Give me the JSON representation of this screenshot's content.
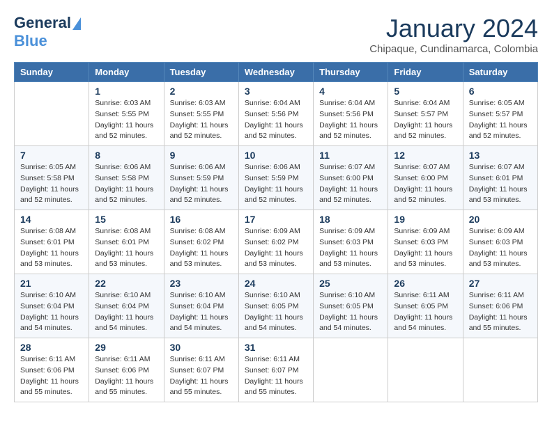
{
  "header": {
    "logo_line1": "General",
    "logo_line2": "Blue",
    "month_title": "January 2024",
    "subtitle": "Chipaque, Cundinamarca, Colombia"
  },
  "days_of_week": [
    "Sunday",
    "Monday",
    "Tuesday",
    "Wednesday",
    "Thursday",
    "Friday",
    "Saturday"
  ],
  "weeks": [
    [
      {
        "day": "",
        "info": ""
      },
      {
        "day": "1",
        "info": "Sunrise: 6:03 AM\nSunset: 5:55 PM\nDaylight: 11 hours\nand 52 minutes."
      },
      {
        "day": "2",
        "info": "Sunrise: 6:03 AM\nSunset: 5:55 PM\nDaylight: 11 hours\nand 52 minutes."
      },
      {
        "day": "3",
        "info": "Sunrise: 6:04 AM\nSunset: 5:56 PM\nDaylight: 11 hours\nand 52 minutes."
      },
      {
        "day": "4",
        "info": "Sunrise: 6:04 AM\nSunset: 5:56 PM\nDaylight: 11 hours\nand 52 minutes."
      },
      {
        "day": "5",
        "info": "Sunrise: 6:04 AM\nSunset: 5:57 PM\nDaylight: 11 hours\nand 52 minutes."
      },
      {
        "day": "6",
        "info": "Sunrise: 6:05 AM\nSunset: 5:57 PM\nDaylight: 11 hours\nand 52 minutes."
      }
    ],
    [
      {
        "day": "7",
        "info": "Sunrise: 6:05 AM\nSunset: 5:58 PM\nDaylight: 11 hours\nand 52 minutes."
      },
      {
        "day": "8",
        "info": "Sunrise: 6:06 AM\nSunset: 5:58 PM\nDaylight: 11 hours\nand 52 minutes."
      },
      {
        "day": "9",
        "info": "Sunrise: 6:06 AM\nSunset: 5:59 PM\nDaylight: 11 hours\nand 52 minutes."
      },
      {
        "day": "10",
        "info": "Sunrise: 6:06 AM\nSunset: 5:59 PM\nDaylight: 11 hours\nand 52 minutes."
      },
      {
        "day": "11",
        "info": "Sunrise: 6:07 AM\nSunset: 6:00 PM\nDaylight: 11 hours\nand 52 minutes."
      },
      {
        "day": "12",
        "info": "Sunrise: 6:07 AM\nSunset: 6:00 PM\nDaylight: 11 hours\nand 52 minutes."
      },
      {
        "day": "13",
        "info": "Sunrise: 6:07 AM\nSunset: 6:01 PM\nDaylight: 11 hours\nand 53 minutes."
      }
    ],
    [
      {
        "day": "14",
        "info": "Sunrise: 6:08 AM\nSunset: 6:01 PM\nDaylight: 11 hours\nand 53 minutes."
      },
      {
        "day": "15",
        "info": "Sunrise: 6:08 AM\nSunset: 6:01 PM\nDaylight: 11 hours\nand 53 minutes."
      },
      {
        "day": "16",
        "info": "Sunrise: 6:08 AM\nSunset: 6:02 PM\nDaylight: 11 hours\nand 53 minutes."
      },
      {
        "day": "17",
        "info": "Sunrise: 6:09 AM\nSunset: 6:02 PM\nDaylight: 11 hours\nand 53 minutes."
      },
      {
        "day": "18",
        "info": "Sunrise: 6:09 AM\nSunset: 6:03 PM\nDaylight: 11 hours\nand 53 minutes."
      },
      {
        "day": "19",
        "info": "Sunrise: 6:09 AM\nSunset: 6:03 PM\nDaylight: 11 hours\nand 53 minutes."
      },
      {
        "day": "20",
        "info": "Sunrise: 6:09 AM\nSunset: 6:03 PM\nDaylight: 11 hours\nand 53 minutes."
      }
    ],
    [
      {
        "day": "21",
        "info": "Sunrise: 6:10 AM\nSunset: 6:04 PM\nDaylight: 11 hours\nand 54 minutes."
      },
      {
        "day": "22",
        "info": "Sunrise: 6:10 AM\nSunset: 6:04 PM\nDaylight: 11 hours\nand 54 minutes."
      },
      {
        "day": "23",
        "info": "Sunrise: 6:10 AM\nSunset: 6:04 PM\nDaylight: 11 hours\nand 54 minutes."
      },
      {
        "day": "24",
        "info": "Sunrise: 6:10 AM\nSunset: 6:05 PM\nDaylight: 11 hours\nand 54 minutes."
      },
      {
        "day": "25",
        "info": "Sunrise: 6:10 AM\nSunset: 6:05 PM\nDaylight: 11 hours\nand 54 minutes."
      },
      {
        "day": "26",
        "info": "Sunrise: 6:11 AM\nSunset: 6:05 PM\nDaylight: 11 hours\nand 54 minutes."
      },
      {
        "day": "27",
        "info": "Sunrise: 6:11 AM\nSunset: 6:06 PM\nDaylight: 11 hours\nand 55 minutes."
      }
    ],
    [
      {
        "day": "28",
        "info": "Sunrise: 6:11 AM\nSunset: 6:06 PM\nDaylight: 11 hours\nand 55 minutes."
      },
      {
        "day": "29",
        "info": "Sunrise: 6:11 AM\nSunset: 6:06 PM\nDaylight: 11 hours\nand 55 minutes."
      },
      {
        "day": "30",
        "info": "Sunrise: 6:11 AM\nSunset: 6:07 PM\nDaylight: 11 hours\nand 55 minutes."
      },
      {
        "day": "31",
        "info": "Sunrise: 6:11 AM\nSunset: 6:07 PM\nDaylight: 11 hours\nand 55 minutes."
      },
      {
        "day": "",
        "info": ""
      },
      {
        "day": "",
        "info": ""
      },
      {
        "day": "",
        "info": ""
      }
    ]
  ]
}
